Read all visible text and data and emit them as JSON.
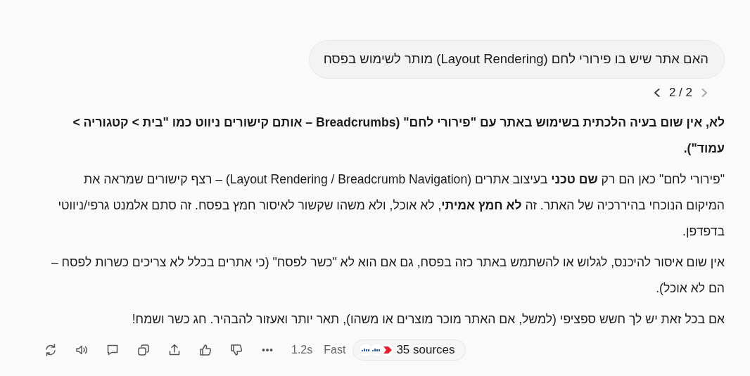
{
  "user_message": {
    "text": "האם אתר שיש בו פירורי לחם (Layout Rendering) מותר לשימוש בפסח"
  },
  "pager": {
    "previous": {
      "disabled": false
    },
    "label": "2 / 2",
    "next": {
      "disabled": true
    }
  },
  "answer": {
    "paragraphs": [
      {
        "text": "לא, אין שום בעיה הלכתית בשימוש באתר עם \"פירורי לחם\" (Breadcrumbs – אותם קישורים ניווט כמו \"בית > קטגוריה > עמוד\").",
        "bold": true
      },
      {
        "text": "\"פירורי לחם\" כאן הם רק **שם טכני** בעיצוב אתרים (Layout Rendering / Breadcrumb Navigation) – רצף קישורים שמראה את המיקום הנוכחי בהיררכיה של האתר. זה **לא חמץ אמיתי**, לא אוכל, ולא משהו שקשור לאיסור חמץ בפסח. זה סתם אלמנט גרפי/ניווטי בדפדפן.",
        "bold": false
      },
      {
        "text": "אין שום איסור להיכנס, לגלוש או להשתמש באתר כזה בפסח, גם אם הוא לא \"כשר לפסח\" (כי אתרים בכלל לא צריכים כשרות לפסח – הם לא אוכל).",
        "bold": false
      },
      {
        "text": "אם בכל זאת יש לך חשש ספציפי (למשל, אם האתר מוכר מוצרים או משהו), תאר יותר ואעזור להבהיר. חג כשר ושמח!",
        "bold": false
      }
    ]
  },
  "toolbar": {
    "actions": [
      {
        "kind": "regenerate"
      },
      {
        "kind": "speaker"
      },
      {
        "kind": "comment"
      },
      {
        "kind": "copy"
      },
      {
        "kind": "share"
      },
      {
        "kind": "like"
      },
      {
        "kind": "dislike"
      },
      {
        "kind": "more"
      }
    ],
    "time": "1.2s",
    "mode": "Fast",
    "sources": {
      "label": "35 sources",
      "favicons": [
        {
          "kind": "bars"
        },
        {
          "kind": "bars"
        },
        {
          "kind": "arrow"
        }
      ]
    }
  }
}
